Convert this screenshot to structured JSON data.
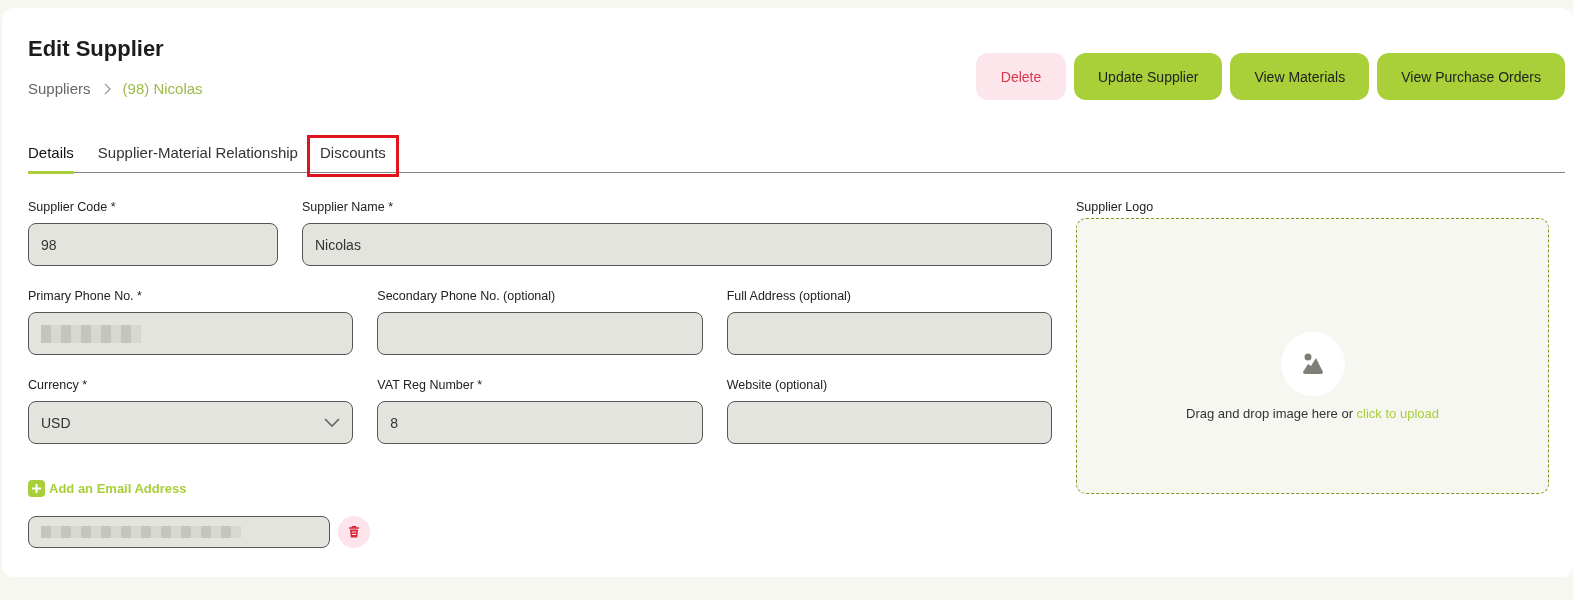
{
  "header": {
    "title": "Edit Supplier",
    "breadcrumb": [
      {
        "label": "Suppliers",
        "current": false
      },
      {
        "label": "(98) Nicolas",
        "current": true
      }
    ]
  },
  "actions": [
    {
      "label": "Delete",
      "kind": "danger"
    },
    {
      "label": "Update Supplier",
      "kind": "primary"
    },
    {
      "label": "View Materials",
      "kind": "primary"
    },
    {
      "label": "View Purchase Orders",
      "kind": "primary"
    }
  ],
  "tabs": [
    {
      "label": "Details",
      "selected": true,
      "highlighted": false
    },
    {
      "label": "Supplier-Material Relationship",
      "selected": false,
      "highlighted": false
    },
    {
      "label": "Discounts",
      "selected": false,
      "highlighted": true
    }
  ],
  "form_rows": [
    [
      {
        "label": "Supplier Code *",
        "kind": "text",
        "value": "98"
      },
      {
        "label": "Supplier Name *",
        "kind": "text",
        "value": "Nicolas"
      }
    ],
    [
      {
        "label": "Primary Phone No. *",
        "kind": "redacted"
      },
      {
        "label": "Secondary Phone No. (optional)",
        "kind": "text"
      },
      {
        "label": "Full Address (optional)",
        "kind": "text"
      }
    ],
    [
      {
        "label": "Currency *",
        "kind": "select",
        "value": "USD"
      },
      {
        "label": "VAT Reg Number *",
        "kind": "text",
        "value": "8"
      },
      {
        "label": "Website (optional)",
        "kind": "text"
      }
    ]
  ],
  "add_email": {
    "label": "Add an Email Address"
  },
  "emails": [
    {
      "kind": "redacted"
    }
  ],
  "logo": {
    "label": "Supplier Logo",
    "hint": "Drag and drop image here or",
    "link": "click to upload"
  }
}
